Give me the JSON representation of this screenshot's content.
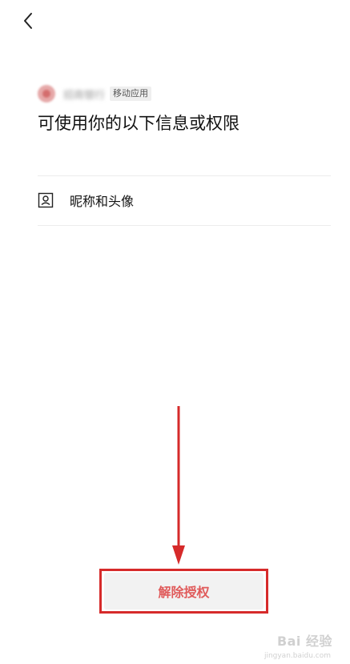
{
  "header": {
    "back_icon": "chevron-left-icon"
  },
  "app": {
    "name": "招商银行",
    "tag": "移动应用",
    "logo_icon": "app-logo-icon"
  },
  "page": {
    "title": "可使用你的以下信息或权限"
  },
  "permissions": [
    {
      "icon": "portrait-icon",
      "label": "昵称和头像"
    }
  ],
  "actions": {
    "revoke_label": "解除授权"
  },
  "annotation": {
    "arrow_icon": "down-arrow-icon",
    "highlight_color": "#d62a2a"
  },
  "colors": {
    "revoke_text": "#e05b5b",
    "button_bg": "#f2f2f2"
  },
  "watermark": {
    "text": "Bai 经验",
    "sub": "jingyan.baidu.com"
  }
}
